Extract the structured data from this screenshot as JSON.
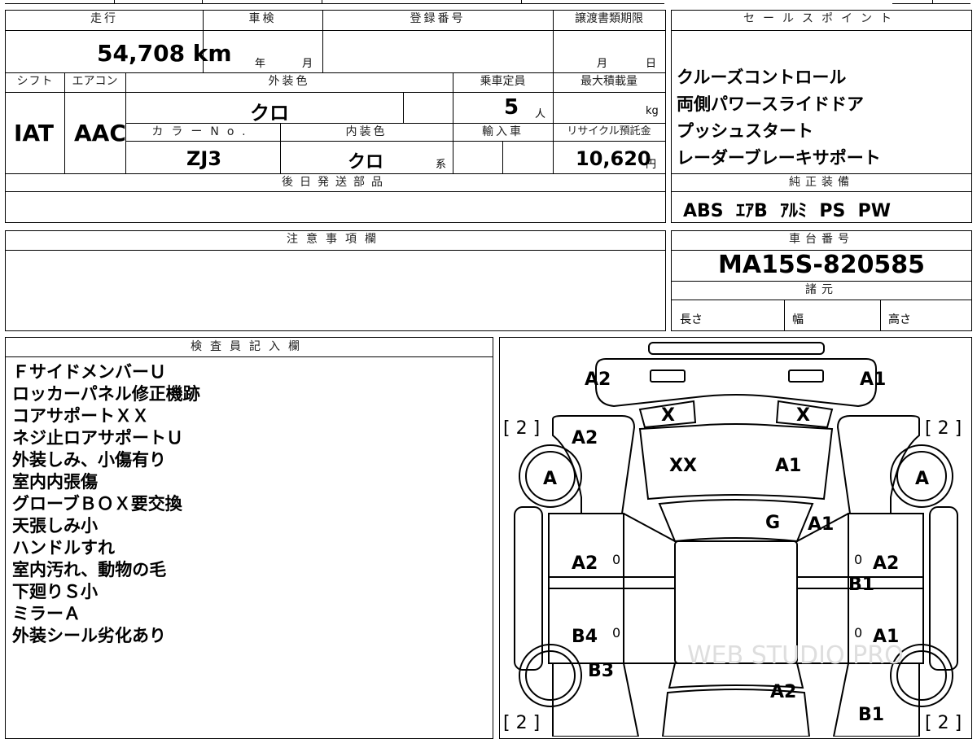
{
  "basic": {
    "mileage_label": "走行",
    "mileage_value": "54,708 km",
    "inspection_label": "車検",
    "inspection_year_unit": "年",
    "inspection_month_unit": "月",
    "registration_label": "登録番号",
    "transfer_deadline_label": "譲渡書類期限",
    "transfer_month_unit": "月",
    "transfer_day_unit": "日",
    "shift_label": "シフト",
    "shift_value": "IAT",
    "aircon_label": "エアコン",
    "aircon_value": "AAC",
    "exterior_color_label": "外装色",
    "exterior_color_value": "クロ",
    "capacity_label": "乗車定員",
    "capacity_value": "5",
    "capacity_unit": "人",
    "max_load_label": "最大積載量",
    "max_load_unit": "kg",
    "color_no_label": "カラーNo.",
    "color_no_value": "ZJ3",
    "interior_color_label": "内装色",
    "interior_color_value": "クロ",
    "interior_color_suffix": "系",
    "import_label": "輸入車",
    "recycle_label": "リサイクル預託金",
    "recycle_value": "10,620",
    "recycle_unit": "円",
    "later_parts_label": "後日発送部品"
  },
  "sales_points": {
    "label": "セールスポイント",
    "items": [
      "クルーズコントロール",
      "両側パワースライドドア",
      "プッシュスタート",
      "レーダーブレーキサポート"
    ]
  },
  "equipment": {
    "label": "純正装備",
    "value": "ABS  ｴｱB  ｱﾙﾐ  PS  PW"
  },
  "notes": {
    "label": "注意事項欄"
  },
  "chassis": {
    "label": "車台番号",
    "value": "MA15S-820585"
  },
  "specs": {
    "label": "諸元",
    "length": "長さ",
    "width": "幅",
    "height": "高さ"
  },
  "inspector": {
    "label": "検査員記入欄",
    "lines": [
      "ＦサイドメンバーＵ",
      "ロッカーパネル修正機跡",
      "コアサポートＸＸ",
      "ネジ止ロアサポートＵ",
      "外装しみ、小傷有り",
      "室内内張傷",
      "グローブＢＯＸ要交換",
      "天張しみ小",
      "ハンドルすれ",
      "室内汚れ、動物の毛",
      "下廻りＳ小",
      "ミラーＡ",
      "外装シール劣化あり"
    ]
  },
  "diagram": {
    "tire_count": "[ 2 ]",
    "wheel_grade": "A",
    "zero": "0",
    "watermark": "WEB STUDIO PRO",
    "marks": {
      "front_left": "A2",
      "front_right": "A1",
      "headlight_left": "X",
      "headlight_right": "X",
      "fender_left": "A2",
      "hood_left": "XX",
      "hood_right": "A1",
      "windshield": "G",
      "cowl_right": "A1",
      "front_door_left": "A2",
      "front_door_right": "A2",
      "rocker_right": "B1",
      "rear_door_left": "B4",
      "rear_door_right": "A1",
      "quarter_left": "B3",
      "tailgate": "A2",
      "rear_right": "B1"
    }
  }
}
